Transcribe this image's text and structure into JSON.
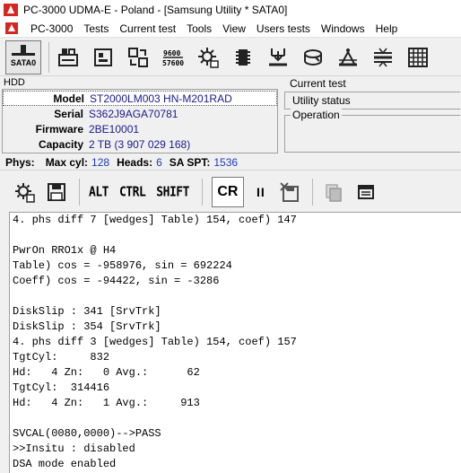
{
  "window": {
    "title": "PC-3000 UDMA-E - Poland - [Samsung Utility * SATA0]"
  },
  "menu": {
    "items": [
      "PC-3000",
      "Tests",
      "Current test",
      "Tools",
      "View",
      "Users tests",
      "Windows",
      "Help"
    ]
  },
  "toolbar": {
    "port_label": "SATA0"
  },
  "hdd": {
    "label": "HDD",
    "rows": [
      {
        "key": "Model",
        "value": "ST2000LM003 HN-M201RAD"
      },
      {
        "key": "Serial",
        "value": "S362J9AGA70781"
      },
      {
        "key": "Firmware",
        "value": "2BE10001"
      },
      {
        "key": "Capacity",
        "value": "2 TB (3 907 029 168)"
      }
    ]
  },
  "current_test": {
    "label": "Current test",
    "status": "Utility status",
    "operation_label": "Operation"
  },
  "phys": {
    "label": "Phys:",
    "max_cyl_label": "Max cyl:",
    "max_cyl": "128",
    "heads_label": "Heads:",
    "heads": "6",
    "spt_label": "SA SPT:",
    "spt": "1536"
  },
  "toolbar2": {
    "alt": "ALT",
    "ctrl": "CTRL",
    "shift": "SHIFT",
    "cr": "CR",
    "pause": "II"
  },
  "log": {
    "lines": [
      "4. phs diff 7 [wedges] Table) 154, coef) 147",
      "",
      "PwrOn RRO1x @ H4",
      "Table) cos = -958976, sin = 692224",
      "Coeff) cos = -94422, sin = -3286",
      "",
      "DiskSlip : 341 [SrvTrk]",
      "DiskSlip : 354 [SrvTrk]",
      "4. phs diff 3 [wedges] Table) 154, coef) 157",
      "TgtCyl:     832",
      "Hd:   4 Zn:   0 Avg.:      62",
      "TgtCyl:  314416",
      "Hd:   4 Zn:   1 Avg.:     913",
      "",
      "SVCAL(0080,0000)-->PASS",
      ">>Insitu : disabled",
      "DSA mode enabled"
    ]
  },
  "colors": {
    "value_text": "#1a1a8c",
    "phys_value": "#1a3dbf",
    "brand_red": "#d7261e"
  }
}
